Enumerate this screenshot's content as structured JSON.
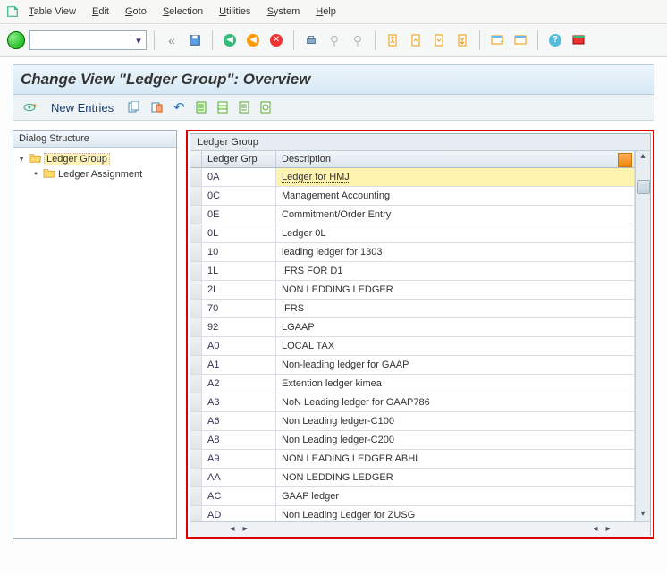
{
  "menu": {
    "items": [
      {
        "pre": "T",
        "rest": "able View"
      },
      {
        "pre": "E",
        "rest": "dit"
      },
      {
        "pre": "G",
        "rest": "oto"
      },
      {
        "pre": "S",
        "rest": "election"
      },
      {
        "pre": "U",
        "rest": "tilities"
      },
      {
        "pre": "S",
        "rest": "ystem"
      },
      {
        "pre": "H",
        "rest": "elp"
      }
    ]
  },
  "title": "Change View \"Ledger Group\": Overview",
  "actions": {
    "new_entries": "New Entries"
  },
  "dialog": {
    "header": "Dialog Structure",
    "node0": "Ledger Group",
    "node1": "Ledger Assignment"
  },
  "table": {
    "title": "Ledger Group",
    "col1": "Ledger Grp",
    "col2": "Description",
    "rows": [
      {
        "g": "0A",
        "d": "Ledger for HMJ",
        "hi": true
      },
      {
        "g": "0C",
        "d": "Management Accounting"
      },
      {
        "g": "0E",
        "d": "Commitment/Order Entry"
      },
      {
        "g": "0L",
        "d": "Ledger 0L"
      },
      {
        "g": "10",
        "d": "leading ledger for 1303"
      },
      {
        "g": "1L",
        "d": "IFRS FOR D1"
      },
      {
        "g": "2L",
        "d": "NON LEDDING LEDGER"
      },
      {
        "g": "70",
        "d": "IFRS"
      },
      {
        "g": "92",
        "d": "LGAAP"
      },
      {
        "g": "A0",
        "d": "LOCAL TAX"
      },
      {
        "g": "A1",
        "d": "Non-leading ledger for GAAP"
      },
      {
        "g": "A2",
        "d": "Extention ledger kimea"
      },
      {
        "g": "A3",
        "d": "NoN Leading ledger for GAAP786"
      },
      {
        "g": "A6",
        "d": "Non Leading ledger-C100"
      },
      {
        "g": "A8",
        "d": "Non Leading ledger-C200"
      },
      {
        "g": "A9",
        "d": "NON LEADING LEDGER ABHI"
      },
      {
        "g": "AA",
        "d": "NON LEDDING LEDGER"
      },
      {
        "g": "AC",
        "d": "GAAP ledger"
      },
      {
        "g": "AD",
        "d": "Non Leading Ledger for ZUSG"
      }
    ]
  }
}
